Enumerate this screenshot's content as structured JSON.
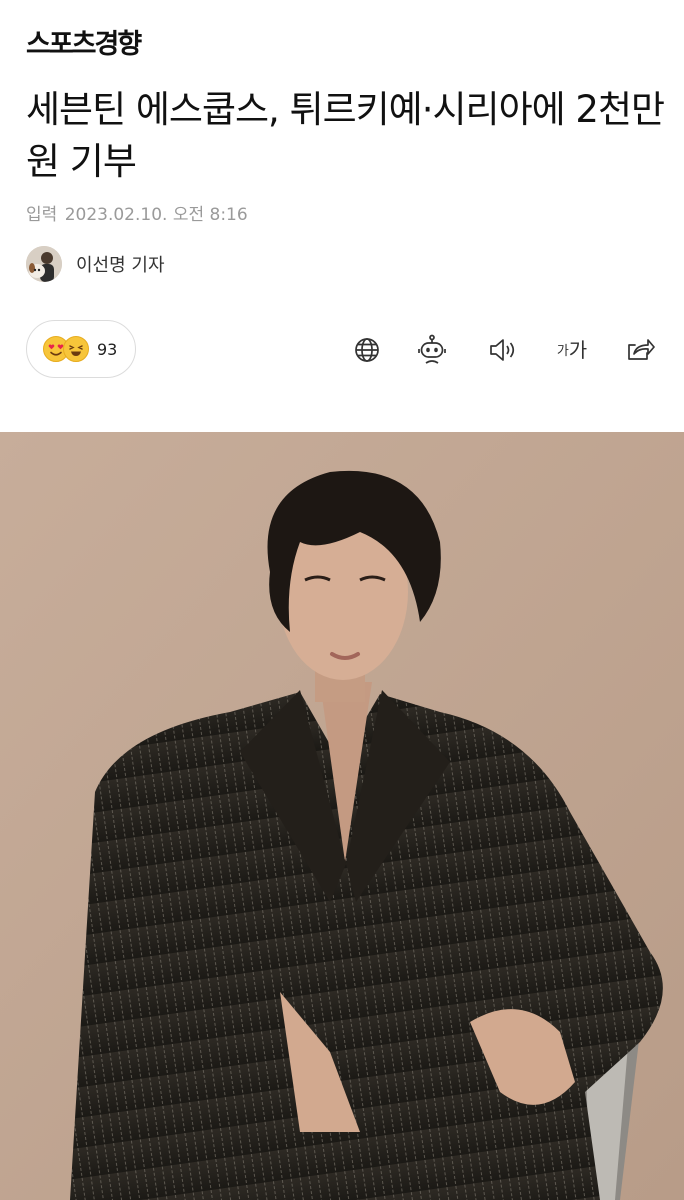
{
  "header": {
    "logo": "스포츠경향"
  },
  "article": {
    "title": "세븐틴 에스쿱스, 튀르키예·시리아에 2천만원 기부",
    "meta_label": "입력",
    "date": "2023.02.10. 오전 8:16",
    "author": "이선명 기자"
  },
  "reactions": {
    "count": "93",
    "icons": [
      "heart-eyes-emoji-icon",
      "grinning-squint-emoji-icon"
    ]
  },
  "toolbar": {
    "icons": [
      "globe-icon",
      "robot-icon",
      "speaker-icon",
      "font-size-icon",
      "share-icon"
    ],
    "font_size_small": "가",
    "font_size_large": "가"
  },
  "colors": {
    "meta_text": "#9a9a9a",
    "photo_bg": "#c2a793",
    "emoji": "#f7c53a",
    "heart": "#e8264b"
  }
}
